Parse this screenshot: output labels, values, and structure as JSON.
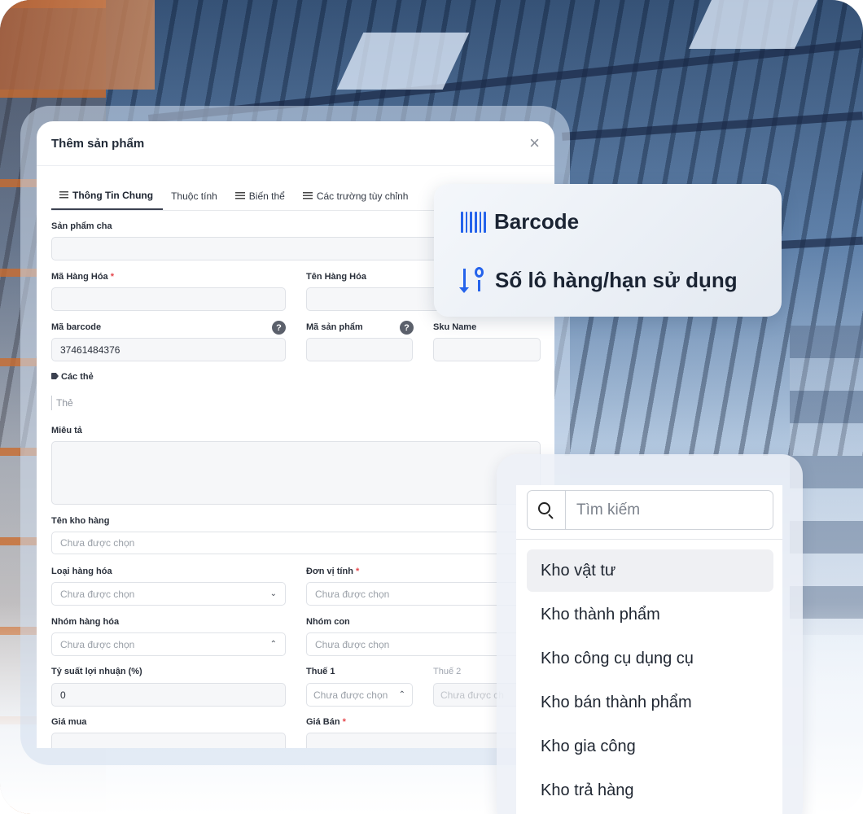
{
  "modal": {
    "title": "Thêm sản phẩm",
    "close_label": "×",
    "tabs": [
      {
        "label": "Thông Tin Chung",
        "icon": "list-icon",
        "active": true
      },
      {
        "label": "Thuộc tính",
        "icon": "",
        "active": false
      },
      {
        "label": "Biến thể",
        "icon": "list-icon",
        "active": false
      },
      {
        "label": "Các trường tùy chỉnh",
        "icon": "list-icon",
        "active": false
      }
    ],
    "fields": {
      "parent_product_label": "Sản phẩm cha",
      "item_code_label": "Mã Hàng Hóa",
      "item_name_label": "Tên Hàng Hóa",
      "barcode_label": "Mã barcode",
      "barcode_value": "37461484376",
      "product_code_label": "Mã sản phẩm",
      "sku_name_label": "Sku Name",
      "tags_label": "Các thẻ",
      "tags_placeholder": "Thẻ",
      "description_label": "Miêu tả",
      "warehouse_label": "Tên kho hàng",
      "warehouse_placeholder": "Chưa được chọn",
      "item_type_label": "Loại hàng hóa",
      "item_type_placeholder": "Chưa được chọn",
      "unit_label": "Đơn vị tính",
      "unit_placeholder": "Chưa được chọn",
      "item_group_label": "Nhóm hàng hóa",
      "item_group_placeholder": "Chưa được chọn",
      "sub_group_label": "Nhóm con",
      "sub_group_placeholder": "Chưa được chọn",
      "profit_rate_label": "Tỷ suất lợi nhuận (%)",
      "profit_rate_value": "0",
      "tax1_label": "Thuế 1",
      "tax1_placeholder": "Chưa được chọn",
      "tax2_label": "Thuế 2",
      "tax2_placeholder": "Chưa được ch",
      "purchase_price_label": "Giá mua",
      "sale_price_label": "Giá Bán",
      "required_mark": "*",
      "help_mark": "?"
    }
  },
  "feature_card": {
    "items": [
      {
        "label": "Barcode",
        "icon": "barcode-icon"
      },
      {
        "label": "Số lô hàng/hạn sử dụng",
        "icon": "sort-numeric-icon"
      }
    ]
  },
  "warehouse_dropdown": {
    "search_placeholder": "Tìm kiếm",
    "options": [
      "Kho vật tư",
      "Kho thành phẩm",
      "Kho công cụ dụng cụ",
      "Kho bán thành phẩm",
      "Kho gia công",
      "Kho trả hàng"
    ],
    "selected_index": 0
  },
  "colors": {
    "accent": "#2563eb",
    "required": "#e5484d"
  }
}
